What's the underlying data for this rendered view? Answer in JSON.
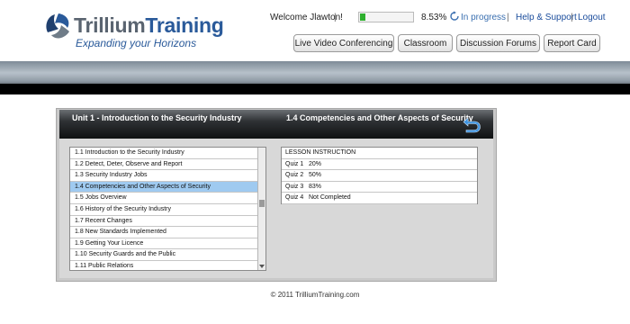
{
  "brand": {
    "name_part1": "Trillium",
    "name_part2": "Training",
    "tagline": "Expanding your Horizons"
  },
  "header": {
    "welcome": "Welcome Jlawton!",
    "progress_percent": 8.53,
    "progress_text": "8.53%",
    "status": "In progress",
    "help_label": "Help & Support",
    "logout_label": "Logout"
  },
  "nav": [
    "Live Video Conferencing",
    "Classroom",
    "Discussion Forums",
    "Report Card"
  ],
  "panel": {
    "unit_title": "Unit  1 - Introduction to the Security Industry",
    "lesson_title": "1.4 Competencies and Other Aspects of Security"
  },
  "lessons": [
    {
      "label": "1.1 Introduction to the Security Industry"
    },
    {
      "label": "1.2 Detect, Deter, Observe and Report"
    },
    {
      "label": "1.3 Security Industry Jobs"
    },
    {
      "label": "1.4 Competencies and Other Aspects of Security",
      "selected": true
    },
    {
      "label": "1.5 Jobs Overview"
    },
    {
      "label": "1.6 History of the Security Industry"
    },
    {
      "label": "1.7 Recent Changes"
    },
    {
      "label": "1.8 New Standards Implemented"
    },
    {
      "label": "1.9 Getting Your Licence"
    },
    {
      "label": "1.10 Security Guards and the Public"
    },
    {
      "label": "1.11 Public Relations"
    }
  ],
  "details": {
    "instruction": "LESSON INSTRUCTION",
    "quizzes": [
      {
        "name": "Quiz 1",
        "result": "20%"
      },
      {
        "name": "Quiz 2",
        "result": "50%"
      },
      {
        "name": "Quiz 3",
        "result": "83%"
      },
      {
        "name": "Quiz 4",
        "result": "Not Completed"
      }
    ]
  },
  "footer": "© 2011 TrilliumTraining.com",
  "colors": {
    "brand_blue": "#2a5a9a",
    "progress_green": "#2fb02f",
    "selected_row": "#9fcaf0",
    "link_blue": "#1a4c9c"
  }
}
